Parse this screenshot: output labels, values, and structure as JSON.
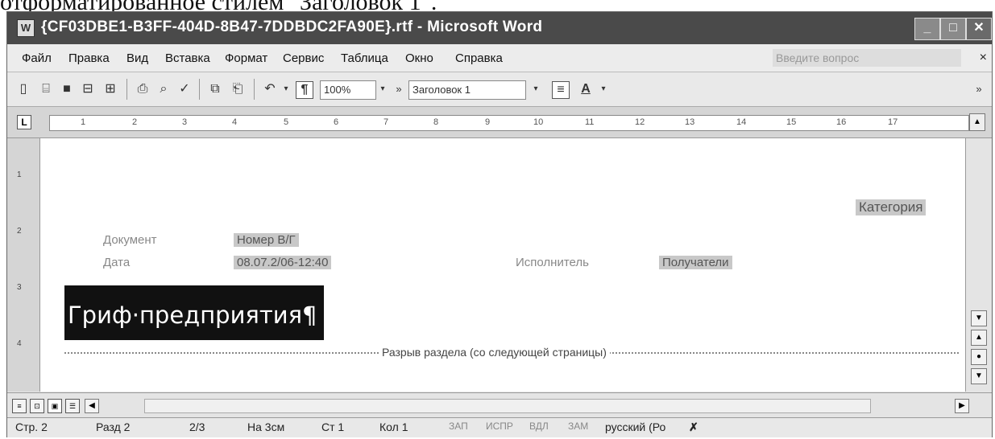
{
  "caption_text": "отформатированное стилем \"Заголовок 1\".",
  "window": {
    "title": "{CF03DBE1-B3FF-404D-8B47-7DDBDC2FA90E}.rtf - Microsoft Word",
    "minimize": "_",
    "maximize": "□",
    "close": "✕"
  },
  "menu": {
    "items": [
      "Файл",
      "Правка",
      "Вид",
      "Вставка",
      "Формат",
      "Сервис",
      "Таблица",
      "Окно",
      "Справка"
    ],
    "help_placeholder": "Введите вопрос",
    "close": "× "
  },
  "toolbar": {
    "zoom": "100%",
    "style": "Заголовок 1",
    "icons": [
      "new-icon",
      "open-icon",
      "save-icon",
      "permission-icon",
      "research-icon",
      "print-icon",
      "print-preview-icon",
      "spelling-icon",
      "copy-icon",
      "paste-icon",
      "undo-icon",
      "pilcrow-icon",
      "align-icon",
      "font-color-icon"
    ]
  },
  "ruler": {
    "ticks": [
      "1",
      "2",
      "3",
      "4",
      "5",
      "6",
      "7",
      "8",
      "9",
      "10",
      "11",
      "12",
      "13",
      "14",
      "15",
      "16",
      "17"
    ]
  },
  "vruler": {
    "ticks": [
      "1",
      "2",
      "3",
      "4"
    ]
  },
  "document": {
    "field_category": "Категория",
    "label_document": "Документ",
    "value_doc_number": "Номер В/Г",
    "label_date": "Дата",
    "value_date": "08.07.2/06-12:40",
    "label_executor": "Исполнитель",
    "value_recipient": "Получатели",
    "heading": "Гриф·предприятия¶",
    "section_break": "Разрыв раздела (со следующей страницы)"
  },
  "status": {
    "page": "Стр. 2",
    "section": "Разд 2",
    "pages": "2/3",
    "at": "На 3см",
    "line": "Ст 1",
    "col": "Кол 1",
    "rec": "ЗАП",
    "trk": "ИСПР",
    "ext": "ВДЛ",
    "ovr": "ЗАМ",
    "lang": "русский (Ро"
  }
}
